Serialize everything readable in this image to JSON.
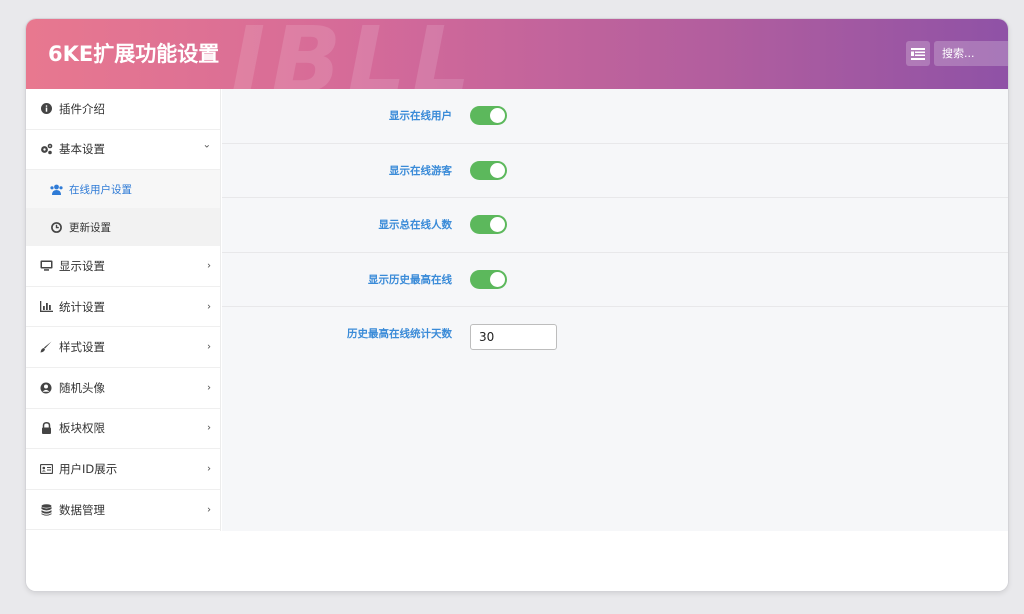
{
  "header": {
    "title": "6KE扩展功能设置",
    "watermark": "JBLL",
    "search_placeholder": "搜索..."
  },
  "sidebar": {
    "items": [
      {
        "label": "插件介绍",
        "icon": "info-circle-icon",
        "chevron": ""
      },
      {
        "label": "基本设置",
        "icon": "cogs-icon",
        "chevron": "⌄"
      },
      {
        "label": "显示设置",
        "icon": "monitor-icon",
        "chevron": "›"
      },
      {
        "label": "统计设置",
        "icon": "bar-chart-icon",
        "chevron": "›"
      },
      {
        "label": "样式设置",
        "icon": "paint-brush-icon",
        "chevron": "›"
      },
      {
        "label": "随机头像",
        "icon": "user-circle-icon",
        "chevron": "›"
      },
      {
        "label": "板块权限",
        "icon": "lock-icon",
        "chevron": "›"
      },
      {
        "label": "用户ID展示",
        "icon": "id-card-icon",
        "chevron": "›"
      },
      {
        "label": "数据管理",
        "icon": "database-icon",
        "chevron": "›"
      }
    ],
    "subitems": [
      {
        "label": "在线用户设置",
        "icon": "users-icon",
        "active": true
      },
      {
        "label": "更新设置",
        "icon": "clock-icon",
        "active": false
      }
    ]
  },
  "settings": [
    {
      "label": "显示在线用户",
      "type": "toggle",
      "on": true
    },
    {
      "label": "显示在线游客",
      "type": "toggle",
      "on": true
    },
    {
      "label": "显示总在线人数",
      "type": "toggle",
      "on": true
    },
    {
      "label": "显示历史最高在线",
      "type": "toggle",
      "on": true
    },
    {
      "label": "历史最高在线统计天数",
      "type": "number",
      "value": "30"
    }
  ],
  "colors": {
    "accent_label": "#3a8bd8",
    "toggle_on": "#5cb85c",
    "header_gradient_start": "#e8788f",
    "header_gradient_end": "#8f52a6"
  }
}
